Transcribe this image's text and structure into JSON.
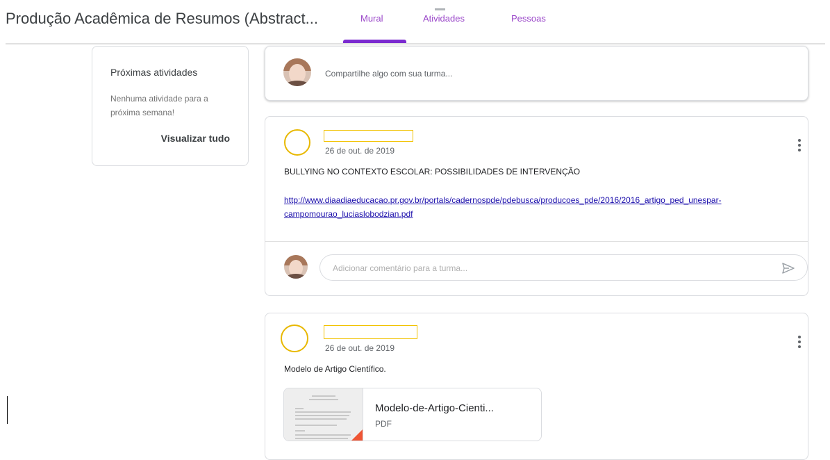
{
  "header": {
    "class_title": "Produção Acadêmica de Resumos (Abstract...",
    "tabs": [
      {
        "label": "Mural",
        "active": true
      },
      {
        "label": "Atividades",
        "active": false
      },
      {
        "label": "Pessoas",
        "active": false
      }
    ]
  },
  "upcoming": {
    "title": "Próximas atividades",
    "empty_text": "Nenhuma atividade para a próxima semana!",
    "view_all": "Visualizar tudo"
  },
  "share": {
    "placeholder": "Compartilhe algo com sua turma..."
  },
  "posts": [
    {
      "date": "26 de out. de 2019",
      "text": "BULLYING NO CONTEXTO ESCOLAR: POSSIBILIDADES DE INTERVENÇÃO",
      "link": "http://www.diaadiaeducacao.pr.gov.br/portals/cadernospde/pdebusca/producoes_pde/2016/2016_artigo_ped_unespar-campomourao_luciaslobodzian.pdf",
      "comment_placeholder": "Adicionar comentário para a turma..."
    },
    {
      "date": "26 de out. de 2019",
      "text": "Modelo de Artigo Científico.",
      "attachment": {
        "name": "Modelo-de-Artigo-Cienti...",
        "type": "PDF"
      }
    }
  ],
  "colors": {
    "accent": "#7b2bd0",
    "tab_text": "#9a46c9",
    "link": "#1a0dab",
    "avatar_ring": "#e8b800",
    "pdf_corner": "#ef5534"
  },
  "icons": [
    "user-avatar-icon",
    "more-vert-icon",
    "send-icon",
    "pdf-thumbnail-icon"
  ]
}
